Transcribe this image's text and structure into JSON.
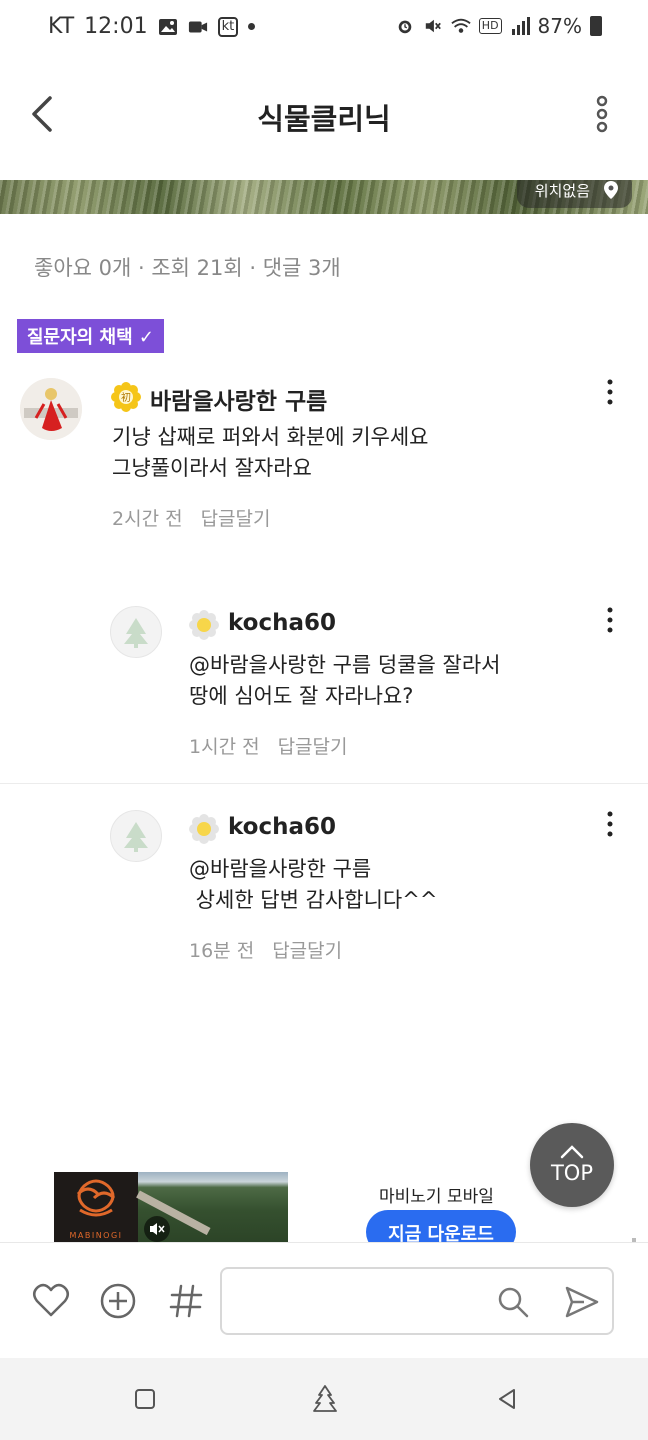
{
  "status_bar": {
    "carrier": "KT",
    "time": "12:01",
    "kt_badge": "kt",
    "hd_badge": "HD",
    "battery": "87%",
    "icons": [
      "gallery-icon",
      "video-icon",
      "kt-icon",
      "alarm-icon",
      "mute-icon",
      "wifi-icon",
      "hd-icon",
      "signal-icon",
      "battery-icon"
    ]
  },
  "header": {
    "title": "식물클리닉"
  },
  "photo": {
    "location_label": "위치없음"
  },
  "stats": {
    "text": "좋아요 0개 · 조회 21회 · 댓글 3개"
  },
  "adopted_badge": "질문자의 채택 ✓",
  "comments": [
    {
      "author": "바람을사랑한 구름",
      "level_badge": "初",
      "text": "기냥 삽째로 퍼와서 화분에 키우세요\n그냥풀이라서 잘자라요",
      "time": "2시간 전",
      "reply": "답글달기"
    },
    {
      "author": "kocha60",
      "text": "@바람을사랑한 구름 덩쿨을 잘라서\n땅에 심어도 잘 자라나요?",
      "time": "1시간 전",
      "reply": "답글달기"
    },
    {
      "author": "kocha60",
      "text": "@바람을사랑한 구름\n 상세한 답변 감사합니다^^",
      "time": "16분 전",
      "reply": "답글달기"
    }
  ],
  "ad": {
    "brand": "MABINOGI",
    "title": "마비노기 모바일",
    "cta": "지금 다운로드"
  },
  "top_button": "TOP",
  "composer": {
    "placeholder": ""
  },
  "colors": {
    "accent_purple": "#7d4fd8",
    "cta_blue": "#2a6cf0",
    "top_button": "#5a5a5a"
  }
}
